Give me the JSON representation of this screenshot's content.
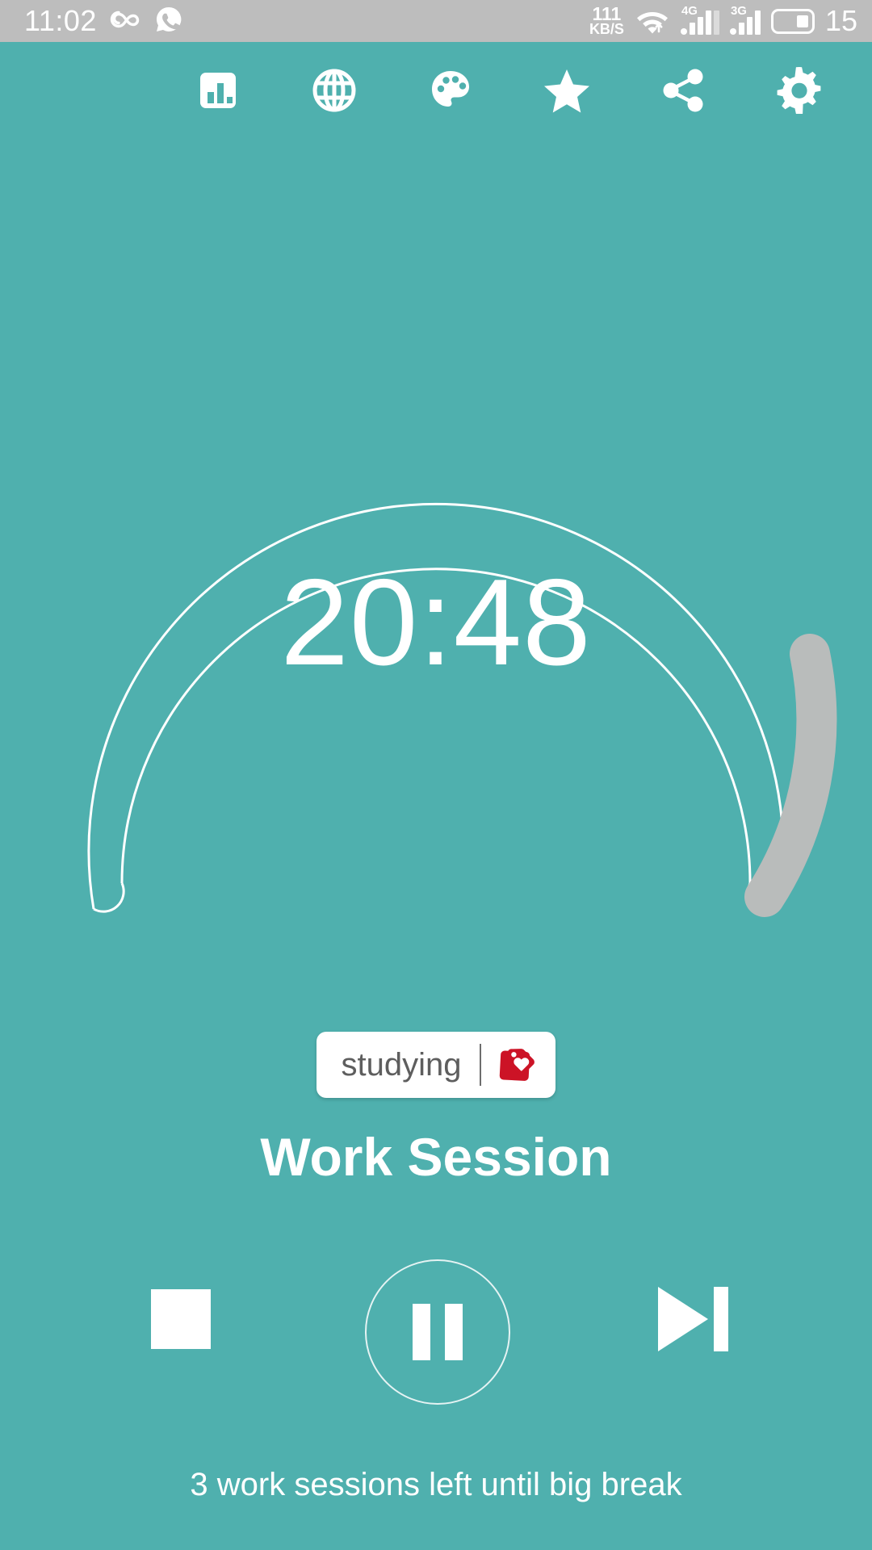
{
  "status_bar": {
    "clock": "11:02",
    "icons_left": [
      "infinity-icon",
      "whatsapp-call-icon"
    ],
    "net_speed_value": "111",
    "net_speed_unit": "KB/S",
    "wifi": "wifi-icon",
    "sim1_label": "4G",
    "sim2_label": "3G",
    "battery_level": "15",
    "background": "#bdbdbd"
  },
  "toolbar": {
    "items": [
      {
        "name": "statistics-icon",
        "label": "Statistics"
      },
      {
        "name": "globe-icon",
        "label": "Language"
      },
      {
        "name": "palette-icon",
        "label": "Themes"
      },
      {
        "name": "star-icon",
        "label": "Rate"
      },
      {
        "name": "share-icon",
        "label": "Share"
      },
      {
        "name": "gear-icon",
        "label": "Settings"
      }
    ]
  },
  "timer": {
    "remaining": "20:48",
    "track_color": "#ffffff",
    "progress_color": "#b9bcbb",
    "progress_percent": 35
  },
  "tag": {
    "label": "studying",
    "icon": "price-tag-heart-icon",
    "icon_color": "#cc1326",
    "chip_background": "#ffffff",
    "text_color": "#5e5e5e"
  },
  "session": {
    "title": "Work Session"
  },
  "controls": [
    {
      "name": "stop-button",
      "label": "Stop"
    },
    {
      "name": "pause-button",
      "label": "Pause"
    },
    {
      "name": "skip-next-button",
      "label": "Skip"
    }
  ],
  "footer": {
    "note": "3 work sessions left until big break"
  },
  "theme": {
    "background": "#4fb0ae",
    "foreground": "#ffffff"
  }
}
